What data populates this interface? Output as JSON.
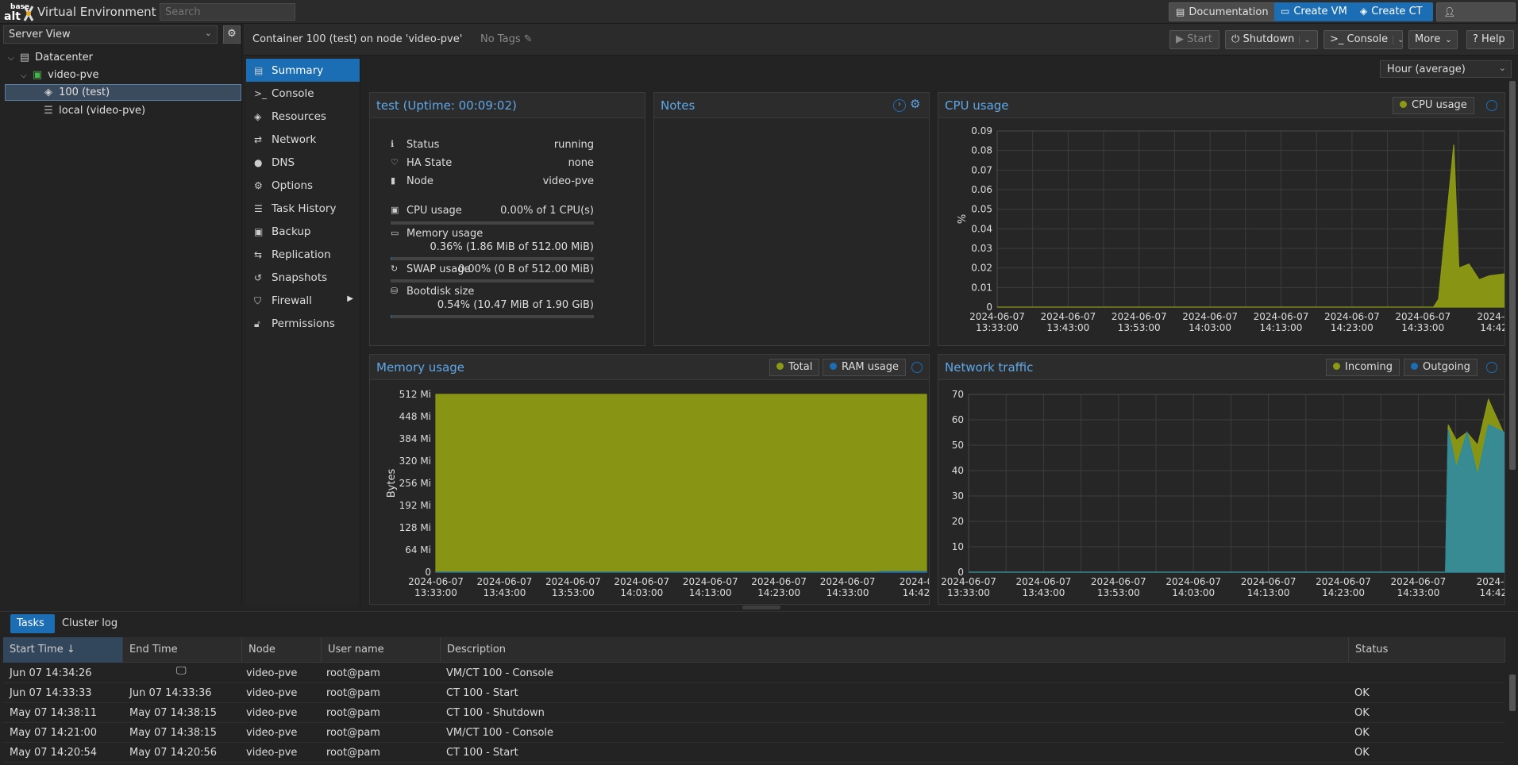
{
  "topbar": {
    "logo_top": "base",
    "logo_bottom": "alt",
    "app_title": "Virtual Environment",
    "search_placeholder": "Search",
    "doc_label": "Documentation",
    "create_vm_label": "Create VM",
    "create_ct_label": "Create CT",
    "user_label": ""
  },
  "tree": {
    "view": "Server View",
    "items": [
      {
        "label": "Datacenter",
        "icon": "datacenter-icon"
      },
      {
        "label": "video-pve",
        "icon": "node-icon"
      },
      {
        "label": "100 (test)",
        "icon": "container-icon",
        "selected": true
      },
      {
        "label": "local (video-pve)",
        "icon": "storage-icon"
      }
    ]
  },
  "header": {
    "title": "Container 100 (test) on node 'video-pve'",
    "tags": "No Tags",
    "start": "Start",
    "shutdown": "Shutdown",
    "console": "Console",
    "more": "More",
    "help": "Help"
  },
  "nav": [
    {
      "label": "Summary",
      "icon": "book-icon",
      "selected": true
    },
    {
      "label": "Console",
      "icon": "terminal-icon"
    },
    {
      "label": "Resources",
      "icon": "cube-icon"
    },
    {
      "label": "Network",
      "icon": "exchange-icon"
    },
    {
      "label": "DNS",
      "icon": "globe-icon"
    },
    {
      "label": "Options",
      "icon": "gear-icon"
    },
    {
      "label": "Task History",
      "icon": "list-icon"
    },
    {
      "label": "Backup",
      "icon": "floppy-icon"
    },
    {
      "label": "Replication",
      "icon": "retweet-icon"
    },
    {
      "label": "Snapshots",
      "icon": "history-icon"
    },
    {
      "label": "Firewall",
      "icon": "shield-icon"
    },
    {
      "label": "Permissions",
      "icon": "unlock-icon"
    }
  ],
  "timeframe": "Hour (average)",
  "status": {
    "title": "test (Uptime: 00:09:02)",
    "rows": [
      {
        "label": "Status",
        "value": "running"
      },
      {
        "label": "HA State",
        "value": "none"
      },
      {
        "label": "Node",
        "value": "video-pve"
      }
    ],
    "cpu": {
      "label": "CPU usage",
      "value": "0.00% of 1 CPU(s)",
      "fraction": 0.0
    },
    "memory": {
      "label": "Memory usage",
      "value": "0.36% (1.86 MiB of 512.00 MiB)",
      "fraction": 0.0036
    },
    "swap": {
      "label": "SWAP usage",
      "value": "0.00% (0 B of 512.00 MiB)",
      "fraction": 0.0
    },
    "bootdisk": {
      "label": "Bootdisk size",
      "value": "0.54% (10.47 MiB of 1.90 GiB)",
      "fraction": 0.0054
    }
  },
  "notes": {
    "title": "Notes"
  },
  "chart_data": [
    {
      "type": "area",
      "title": "CPU usage",
      "ylabel": "%",
      "legend": [
        "CPU usage"
      ],
      "colors": [
        "#8c9a13"
      ],
      "ylim": [
        0,
        0.09
      ],
      "yticks": [
        "0",
        "0.01",
        "0.02",
        "0.03",
        "0.04",
        "0.05",
        "0.06",
        "0.07",
        "0.08",
        "0.09"
      ],
      "xticks": [
        "2024-06-07\n13:33:00",
        "2024-06-07\n13:43:00",
        "2024-06-07\n13:53:00",
        "2024-06-07\n14:03:00",
        "2024-06-07\n14:13:00",
        "2024-06-07\n14:23:00",
        "2024-06-07\n14:33:00",
        "2024-0\n14:42"
      ],
      "x": [
        0,
        0.86,
        0.87,
        0.9,
        0.91,
        0.93,
        0.95,
        0.97,
        1.0
      ],
      "series": [
        {
          "name": "CPU usage",
          "values": [
            0,
            0,
            0.004,
            0.083,
            0.02,
            0.022,
            0.014,
            0.016,
            0.017
          ]
        }
      ]
    },
    {
      "type": "area",
      "title": "Memory usage",
      "ylabel": "Bytes",
      "legend": [
        "Total",
        "RAM usage"
      ],
      "colors": [
        "#8c9a13",
        "#1c6eb4"
      ],
      "ylim": [
        0,
        512
      ],
      "yticks": [
        "0",
        "64 Mi",
        "128 Mi",
        "192 Mi",
        "256 Mi",
        "320 Mi",
        "384 Mi",
        "448 Mi",
        "512 Mi"
      ],
      "xticks": [
        "2024-06-07\n13:33:00",
        "2024-06-07\n13:43:00",
        "2024-06-07\n13:53:00",
        "2024-06-07\n14:03:00",
        "2024-06-07\n14:13:00",
        "2024-06-07\n14:23:00",
        "2024-06-07\n14:33:00",
        "2024-0\n14:42"
      ],
      "x": [
        0,
        0.9,
        0.91,
        1.0
      ],
      "series": [
        {
          "name": "Total",
          "values": [
            512,
            512,
            512,
            512
          ]
        },
        {
          "name": "RAM usage",
          "values": [
            0,
            0,
            1.86,
            1.86
          ]
        }
      ]
    },
    {
      "type": "area",
      "title": "Network traffic",
      "legend": [
        "Incoming",
        "Outgoing"
      ],
      "colors": [
        "#8c9a13",
        "#2a8aa8"
      ],
      "ylim": [
        0,
        70
      ],
      "yticks": [
        "0",
        "10",
        "20",
        "30",
        "40",
        "50",
        "60",
        "70"
      ],
      "xticks": [
        "2024-06-07\n13:33:00",
        "2024-06-07\n13:43:00",
        "2024-06-07\n13:53:00",
        "2024-06-07\n14:03:00",
        "2024-06-07\n14:13:00",
        "2024-06-07\n14:23:00",
        "2024-06-07\n14:33:00",
        "2024-0\n14:42"
      ],
      "x": [
        0,
        0.89,
        0.895,
        0.91,
        0.93,
        0.95,
        0.97,
        1.0
      ],
      "series": [
        {
          "name": "Incoming",
          "values": [
            0,
            0,
            58,
            52,
            55,
            50,
            68,
            54
          ]
        },
        {
          "name": "Outgoing",
          "values": [
            0,
            0,
            56,
            41,
            55,
            38,
            58,
            55
          ]
        }
      ]
    }
  ],
  "bottom": {
    "tabs": [
      "Tasks",
      "Cluster log"
    ],
    "columns": [
      "Start Time",
      "End Time",
      "Node",
      "User name",
      "Description",
      "Status"
    ],
    "rows": [
      {
        "start": "Jun 07 14:34:26",
        "end": "",
        "running": true,
        "node": "video-pve",
        "user": "root@pam",
        "desc": "VM/CT 100 - Console",
        "status": ""
      },
      {
        "start": "Jun 07 14:33:33",
        "end": "Jun 07 14:33:36",
        "running": false,
        "node": "video-pve",
        "user": "root@pam",
        "desc": "CT 100 - Start",
        "status": "OK"
      },
      {
        "start": "May 07 14:38:11",
        "end": "May 07 14:38:15",
        "running": false,
        "node": "video-pve",
        "user": "root@pam",
        "desc": "CT 100 - Shutdown",
        "status": "OK"
      },
      {
        "start": "May 07 14:21:00",
        "end": "May 07 14:38:15",
        "running": false,
        "node": "video-pve",
        "user": "root@pam",
        "desc": "VM/CT 100 - Console",
        "status": "OK"
      },
      {
        "start": "May 07 14:20:54",
        "end": "May 07 14:20:56",
        "running": false,
        "node": "video-pve",
        "user": "root@pam",
        "desc": "CT 100 - Start",
        "status": "OK"
      }
    ]
  }
}
